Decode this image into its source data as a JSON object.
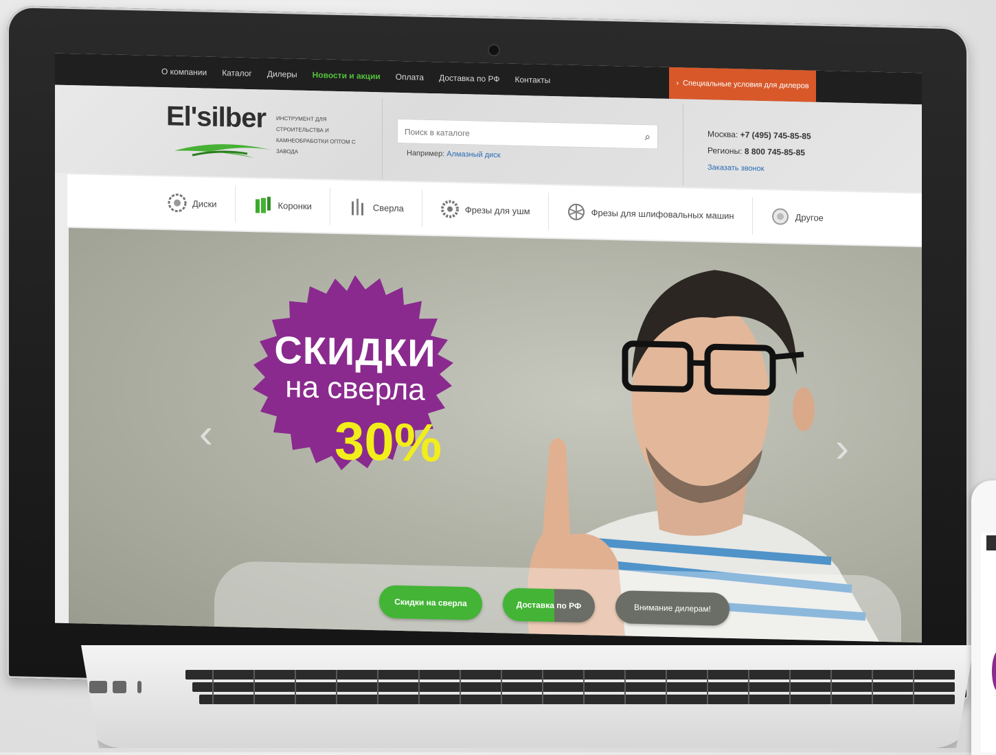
{
  "topnav": {
    "items": [
      "О компании",
      "Каталог",
      "Дилеры",
      "Новости и акции",
      "Оплата",
      "Доставка по РФ",
      "Контакты"
    ],
    "dealer_button": "Специальные условия для дилеров"
  },
  "header": {
    "logo": "El'silber",
    "tagline": "Инструмент для строительства и камнеобработки оптом с завода",
    "search_placeholder": "Поиск в каталоге",
    "example_label": "Например:",
    "example_link": "Алмазный диск",
    "phone_moscow_label": "Москва:",
    "phone_moscow": "+7 (495) 745-85-85",
    "phone_regions_label": "Регионы:",
    "phone_regions": "8 800 745-85-85",
    "callback": "Заказать звонок"
  },
  "categories": [
    {
      "label": "Диски",
      "icon": "disc-icon"
    },
    {
      "label": "Коронки",
      "icon": "crown-bit-icon"
    },
    {
      "label": "Сверла",
      "icon": "drill-bits-icon"
    },
    {
      "label": "Фрезы для ушм",
      "icon": "cutter-icon"
    },
    {
      "label": "Фрезы для шлифовальных машин",
      "icon": "grinding-cutter-icon"
    },
    {
      "label": "Другое",
      "icon": "other-icon"
    }
  ],
  "hero": {
    "badge_line1": "СКИДКИ",
    "badge_line2": "на сверла",
    "badge_line3": "30%",
    "badge_color": "#8a2a8e",
    "pills": [
      "Скидки на сверла",
      "Доставка по РФ",
      "Внимание дилерам!"
    ]
  }
}
